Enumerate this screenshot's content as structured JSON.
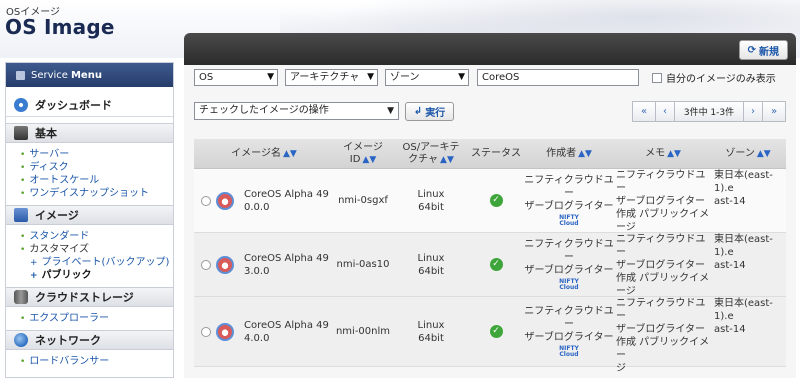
{
  "header": {
    "breadcrumb": "OSイメージ",
    "title": "OS Image"
  },
  "sidebar": {
    "head_prefix": "Service",
    "head_bold": "Menu",
    "dashboard": "ダッシュボード",
    "sections": [
      {
        "label": "基本",
        "items": [
          "サーバー",
          "ディスク",
          "オートスケール",
          "ワンデイスナップショット"
        ]
      },
      {
        "label": "イメージ",
        "items": [
          "スタンダード",
          "カスタマイズ"
        ],
        "subitems": [
          "プライベート(バックアップ)",
          "パブリック"
        ]
      },
      {
        "label": "クラウドストレージ",
        "items": [
          "エクスプローラー"
        ]
      },
      {
        "label": "ネットワーク",
        "items": [
          "ロードバランサー"
        ]
      }
    ]
  },
  "toolbar": {
    "new_label": "新規"
  },
  "filters": {
    "os": "OS",
    "arch": "アーキテクチャ",
    "zone": "ゾーン",
    "search_value": "CoreOS",
    "own_only_label": "自分のイメージのみ表示"
  },
  "actions": {
    "bulk_select": "チェックしたイメージの操作",
    "exec_label": "実行",
    "pager_info": "3件中 1-3件"
  },
  "table": {
    "headers": {
      "name": "イメージ名",
      "id_line1": "イメージ",
      "id_line2": "ID",
      "os_line1": "OS/アーキテ",
      "os_line2": "クチャ",
      "status": "ステータス",
      "creator": "作成者",
      "memo": "メモ",
      "zone": "ゾーン"
    },
    "rows": [
      {
        "name1": "CoreOS Alpha 49",
        "name2": "0.0.0",
        "id": "nmi-0sgxf",
        "os1": "Linux",
        "os2": "64bit",
        "creator1": "ニフティクラウドユー",
        "creator2": "ザーブログライター",
        "badge1": "NIFTY",
        "badge2": "Cloud",
        "memo1": "ニフティクラウドユー",
        "memo2": "ザーブログライター",
        "memo3": "作成 パブリックイメージ",
        "zone1": "東日本(east-1).e",
        "zone2": "ast-14"
      },
      {
        "name1": "CoreOS Alpha 49",
        "name2": "3.0.0",
        "id": "nmi-0as10",
        "os1": "Linux",
        "os2": "64bit",
        "creator1": "ニフティクラウドユー",
        "creator2": "ザーブログライター",
        "badge1": "NIFTY",
        "badge2": "Cloud",
        "memo1": "ニフティクラウドユー",
        "memo2": "ザーブログライター",
        "memo3": "作成 パブリックイメージ",
        "zone1": "東日本(east-1).e",
        "zone2": "ast-14"
      },
      {
        "name1": "CoreOS Alpha 49",
        "name2": "4.0.0",
        "id": "nmi-00nlm",
        "os1": "Linux",
        "os2": "64bit",
        "creator1": "ニフティクラウドユー",
        "creator2": "ザーブログライター",
        "badge1": "NIFTY",
        "badge2": "Cloud",
        "memo1": "ニフティクラウドユー",
        "memo2": "ザーブログライター",
        "memo3": "作成 パブリックイメー",
        "memo4": "ジ",
        "zone1": "東日本(east-1).e",
        "zone2": "ast-14"
      }
    ]
  }
}
